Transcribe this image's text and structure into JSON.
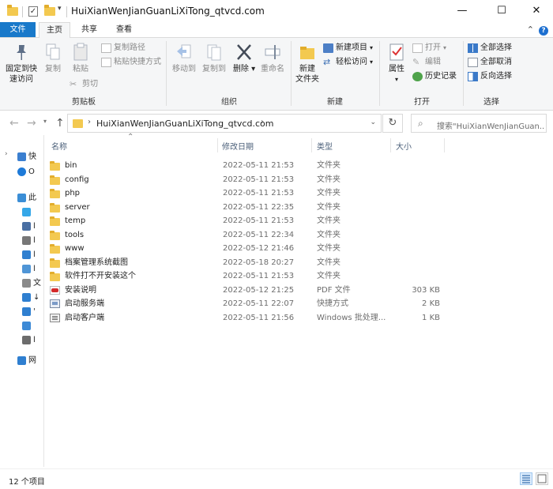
{
  "window": {
    "title": "HuiXianWenJianGuanLiXiTong_qtvcd.com",
    "minimize": "—",
    "maximize": "☐",
    "close": "✕"
  },
  "ribbon_tabs": [
    "文件",
    "主页",
    "共享",
    "查看"
  ],
  "ribbon": {
    "clipboard": {
      "pin": "固定到快速访问",
      "pin_line1": "固定到快",
      "pin_line2": "速访问",
      "copy": "复制",
      "paste": "粘贴",
      "copy_path": "复制路径",
      "paste_shortcut": "粘贴快捷方式",
      "cut": "剪切",
      "label": "剪贴板"
    },
    "organize": {
      "move_to": "移动到",
      "copy_to": "复制到",
      "delete": "删除",
      "rename": "重命名",
      "label": "组织"
    },
    "new": {
      "new_folder_line1": "新建",
      "new_folder_line2": "文件夹",
      "new_item": "新建项目",
      "easy_access": "轻松访问",
      "label": "新建"
    },
    "open": {
      "properties": "属性",
      "open": "打开",
      "edit": "编辑",
      "history": "历史记录",
      "label": "打开"
    },
    "select": {
      "select_all": "全部选择",
      "select_none": "全部取消",
      "invert": "反向选择",
      "label": "选择"
    }
  },
  "address": {
    "path": "HuiXianWenJianGuanLiXiTong_qtvcd.com",
    "search_placeholder": "搜索\"HuiXianWenJianGuan..."
  },
  "nav_pane": {
    "items": [
      {
        "label": "快",
        "icon": "star-icon",
        "color": "#3b7fd0"
      },
      {
        "label": "O",
        "icon": "cloud-icon",
        "color": "#1e7ad8"
      },
      {
        "label": "此",
        "icon": "computer-icon",
        "color": "#3b8ed6"
      },
      {
        "label": "",
        "icon": "cube-icon",
        "color": "#35a7e8"
      },
      {
        "label": "l",
        "icon": "video-icon",
        "color": "#4a6fa3"
      },
      {
        "label": "l",
        "icon": "document-icon",
        "color": "#777777"
      },
      {
        "label": "l",
        "icon": "download-icon",
        "color": "#2f7fd0"
      },
      {
        "label": "l",
        "icon": "picture-icon",
        "color": "#4f95d6"
      },
      {
        "label": "文",
        "icon": "documents-icon",
        "color": "#8a8a8a"
      },
      {
        "label": "↓",
        "icon": "arrow-down-icon",
        "color": "#2f7fd0"
      },
      {
        "label": "'",
        "icon": "music-icon",
        "color": "#2f7fd0"
      },
      {
        "label": "",
        "icon": "desktop-icon",
        "color": "#3d8ad6"
      },
      {
        "label": "l",
        "icon": "drive-icon",
        "color": "#6c6c6c"
      },
      {
        "label": "网",
        "icon": "network-icon",
        "color": "#2f7fd0"
      }
    ]
  },
  "columns": {
    "name": "名称",
    "modified": "修改日期",
    "type": "类型",
    "size": "大小"
  },
  "files": [
    {
      "name": "bin",
      "modified": "2022-05-11 21:53",
      "type": "文件夹",
      "size": "",
      "icon": "folder-icon"
    },
    {
      "name": "config",
      "modified": "2022-05-11 21:53",
      "type": "文件夹",
      "size": "",
      "icon": "folder-icon"
    },
    {
      "name": "php",
      "modified": "2022-05-11 21:53",
      "type": "文件夹",
      "size": "",
      "icon": "folder-icon"
    },
    {
      "name": "server",
      "modified": "2022-05-11 22:35",
      "type": "文件夹",
      "size": "",
      "icon": "folder-icon"
    },
    {
      "name": "temp",
      "modified": "2022-05-11 21:53",
      "type": "文件夹",
      "size": "",
      "icon": "folder-icon"
    },
    {
      "name": "tools",
      "modified": "2022-05-11 22:34",
      "type": "文件夹",
      "size": "",
      "icon": "folder-icon"
    },
    {
      "name": "www",
      "modified": "2022-05-12 21:46",
      "type": "文件夹",
      "size": "",
      "icon": "folder-icon"
    },
    {
      "name": "档案管理系统截图",
      "modified": "2022-05-18 20:27",
      "type": "文件夹",
      "size": "",
      "icon": "folder-icon"
    },
    {
      "name": "软件打不开安装这个",
      "modified": "2022-05-11 21:53",
      "type": "文件夹",
      "size": "",
      "icon": "folder-icon"
    },
    {
      "name": "安装说明",
      "modified": "2022-05-12 21:25",
      "type": "PDF 文件",
      "size": "303 KB",
      "icon": "pdf-icon"
    },
    {
      "name": "启动服务端",
      "modified": "2022-05-11 22:07",
      "type": "快捷方式",
      "size": "2 KB",
      "icon": "shortcut-icon"
    },
    {
      "name": "启动客户端",
      "modified": "2022-05-11 21:56",
      "type": "Windows 批处理...",
      "size": "1 KB",
      "icon": "batch-icon"
    }
  ],
  "status": {
    "item_count": "12 个项目"
  },
  "colors": {
    "file_tab": "#1979ca",
    "folder": "#f3c950",
    "column_header": "#4c607a"
  }
}
